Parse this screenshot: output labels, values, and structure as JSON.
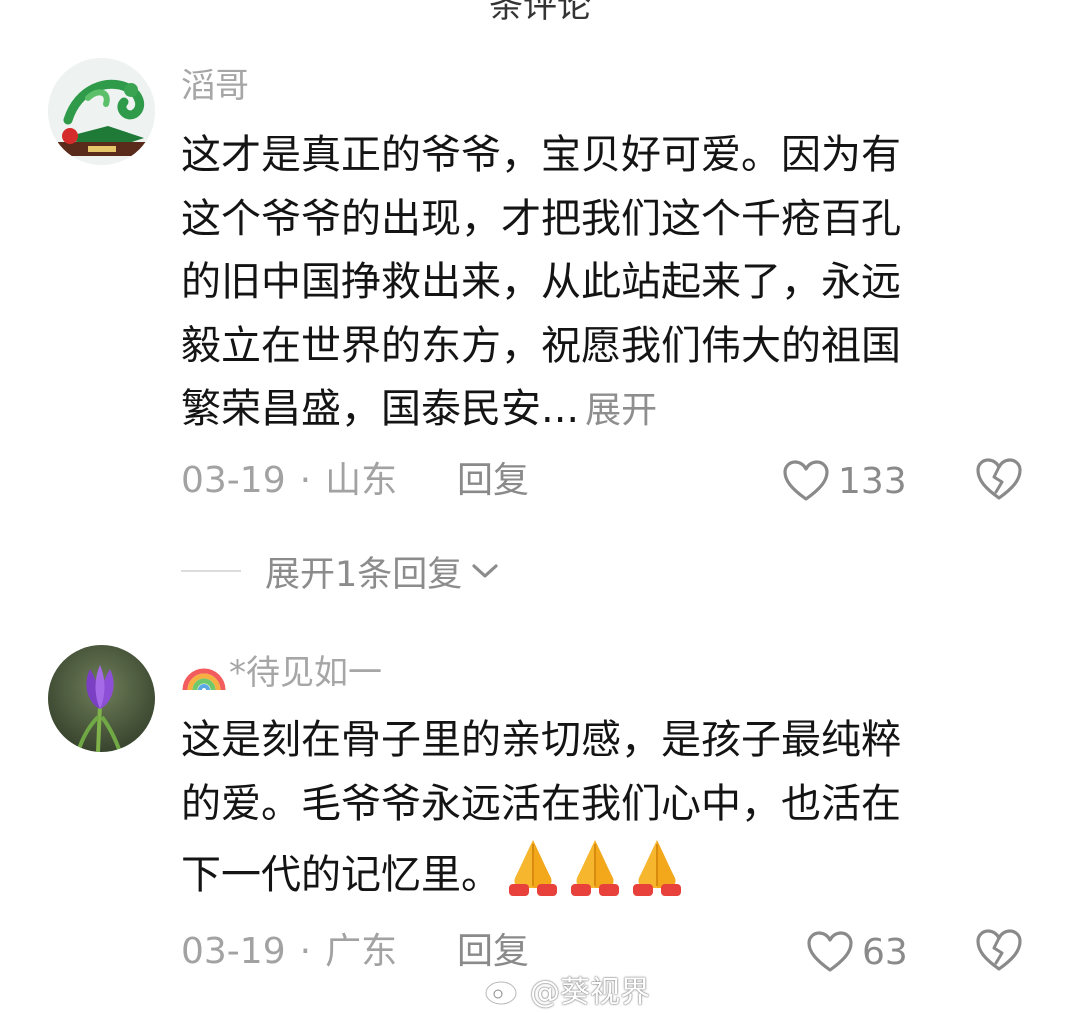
{
  "header": {
    "partial_title": "条评论"
  },
  "comments": [
    {
      "username": "滔哥",
      "text": "这才是真正的爷爷，宝贝好可爱。因为有\n这个爷爷的出现，才把我们这个千疮百孔\n的旧中国挣救出来，从此站起来了，永远\n毅立在世界的东方，祝愿我们伟大的祖国\n繁荣昌盛，国泰民安...",
      "expand_label": "展开",
      "date": "03-19",
      "location": "山东",
      "reply_label": "回复",
      "likes": "133",
      "avatar_icon": "jade-dragon-avatar",
      "expand_replies_label": "展开1条回复"
    },
    {
      "username": "*待见如一",
      "username_icon": "rainbow-emoji",
      "text": "这是刻在骨子里的亲切感，是孩子最纯粹\n的爱。毛爷爷永远活在我们心中，也活在\n下一代的记忆里。",
      "emojis": [
        "folded-hands-emoji",
        "folded-hands-emoji",
        "folded-hands-emoji"
      ],
      "date": "03-19",
      "location": "广东",
      "reply_label": "回复",
      "likes": "63",
      "avatar_icon": "purple-crocus-avatar"
    }
  ],
  "watermark": {
    "text": "@葵视界",
    "icon": "weibo-icon"
  },
  "colors": {
    "meta_gray": "#a2a2a2",
    "text": "#141414",
    "background": "#ffffff"
  }
}
